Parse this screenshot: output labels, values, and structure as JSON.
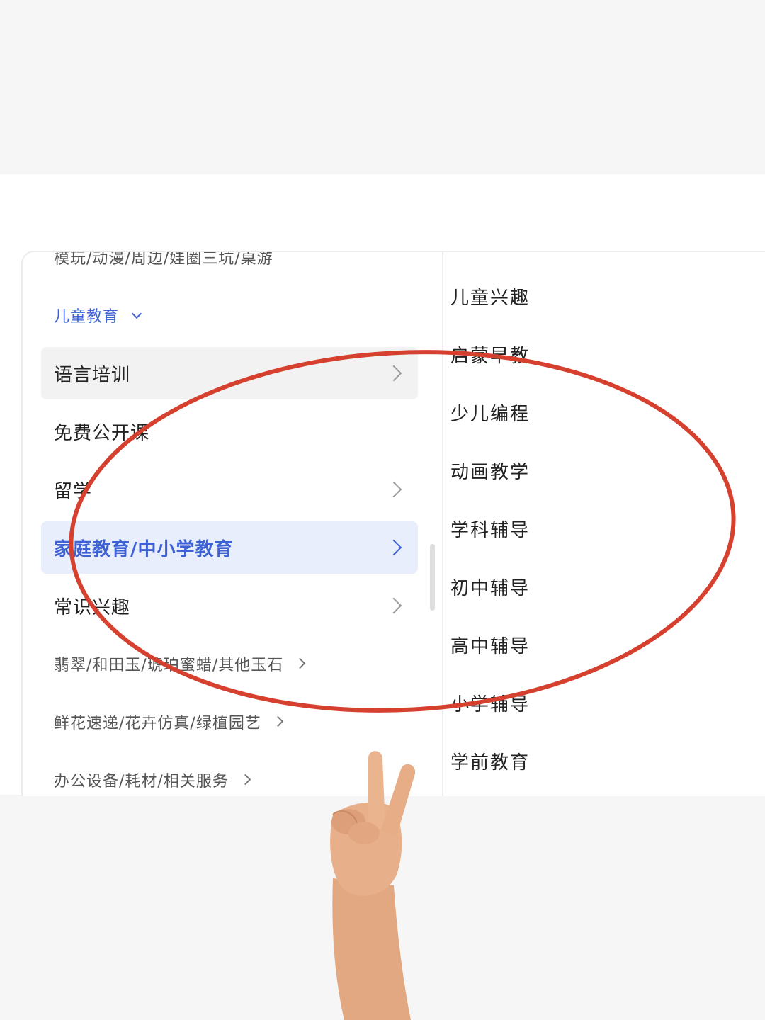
{
  "left_menu": {
    "partial_top_item": "模玩/动漫/周边/娃圈三坑/桌游",
    "section_header": "儿童教育",
    "items": [
      {
        "label": "语言培训"
      },
      {
        "label": "免费公开课"
      },
      {
        "label": "留学"
      },
      {
        "label": "家庭教育/中小学教育"
      },
      {
        "label": "常识兴趣"
      }
    ],
    "other_categories": [
      {
        "label": "翡翠/和田玉/琥珀蜜蜡/其他玉石"
      },
      {
        "label": "鲜花速递/花卉仿真/绿植园艺"
      },
      {
        "label": "办公设备/耗材/相关服务"
      }
    ]
  },
  "right_menu": {
    "items": [
      {
        "label": "儿童兴趣"
      },
      {
        "label": "启蒙早教"
      },
      {
        "label": "少儿编程"
      },
      {
        "label": "动画教学"
      },
      {
        "label": "学科辅导"
      },
      {
        "label": "初中辅导"
      },
      {
        "label": "高中辅导"
      },
      {
        "label": "小学辅导"
      },
      {
        "label": "学前教育"
      }
    ]
  },
  "colors": {
    "accent_blue": "#3e62d6",
    "active_bg": "#e9eefc",
    "annotation_red": "#d6402f"
  },
  "icons": [
    "chevron-right-icon",
    "chevron-down-icon",
    "peace-sign-hand-icon"
  ]
}
